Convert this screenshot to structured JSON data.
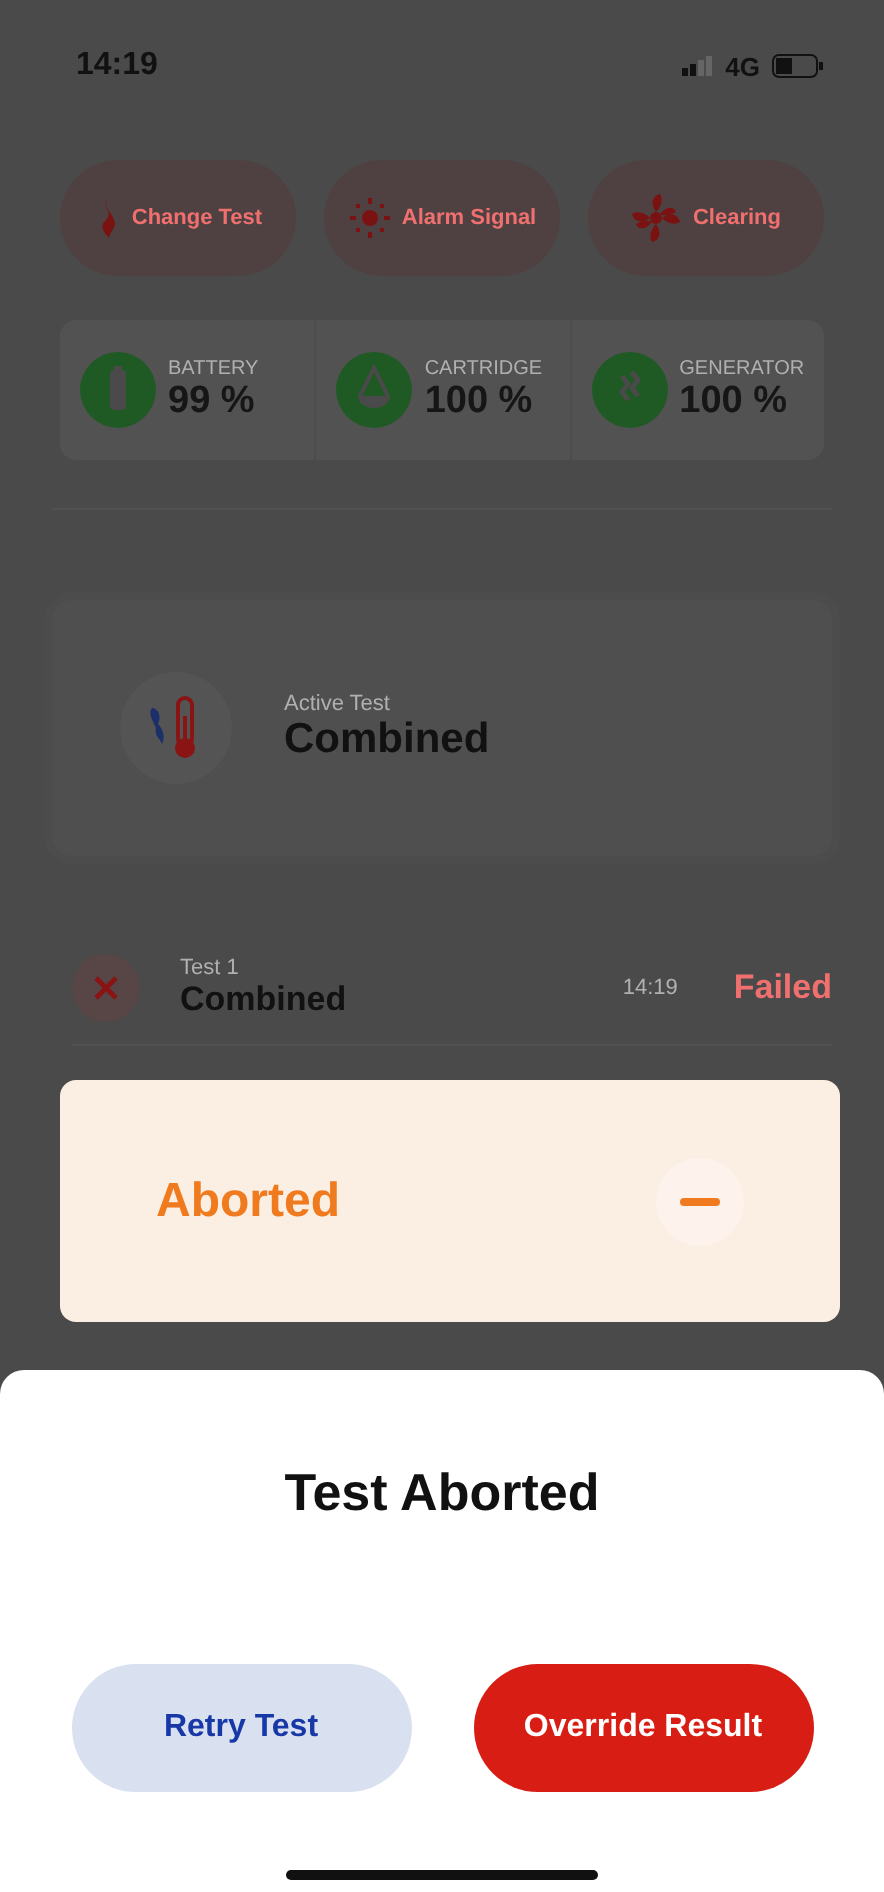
{
  "status_bar": {
    "time": "14:19",
    "network": "4G"
  },
  "actions": [
    {
      "label": "Change Test",
      "kind": "flame"
    },
    {
      "label": "Alarm Signal",
      "kind": "sun"
    },
    {
      "label": "Clearing",
      "kind": "fan"
    }
  ],
  "stats": [
    {
      "label": "BATTERY",
      "value": "99 %",
      "kind": "battery"
    },
    {
      "label": "CARTRIDGE",
      "value": "100 %",
      "kind": "drop"
    },
    {
      "label": "GENERATOR",
      "value": "100 %",
      "kind": "waves"
    }
  ],
  "active_test": {
    "label": "Active Test",
    "name": "Combined"
  },
  "tests": [
    {
      "label": "Test 1",
      "name": "Combined",
      "time": "14:19",
      "status": "Failed"
    }
  ],
  "toast": {
    "label": "Aborted"
  },
  "dialog": {
    "title": "Test Aborted",
    "buttons": [
      {
        "label": "Retry Test",
        "kind": "secondary"
      },
      {
        "label": "Override Result",
        "kind": "primary"
      }
    ]
  }
}
